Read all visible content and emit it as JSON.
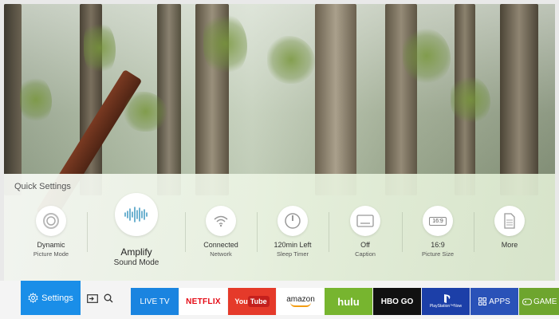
{
  "quick_settings": {
    "title": "Quick Settings",
    "items": [
      {
        "line1": "Dynamic",
        "line2": "Picture Mode",
        "icon": "picture-mode-icon"
      },
      {
        "line1": "Amplify",
        "line2": "Sound Mode",
        "icon": "sound-wave-icon"
      },
      {
        "line1": "Connected",
        "line2": "Network",
        "icon": "wifi-icon"
      },
      {
        "line1": "120min Left",
        "line2": "Sleep Timer",
        "icon": "timer-icon"
      },
      {
        "line1": "Off",
        "line2": "Caption",
        "icon": "caption-icon"
      },
      {
        "line1": "16:9",
        "line2": "Picture Size",
        "icon": "aspect-ratio-icon"
      },
      {
        "line1": "More",
        "line2": "",
        "icon": "document-icon"
      }
    ],
    "aspect_icon_text": "16:9"
  },
  "bar": {
    "settings_label": "Settings",
    "apps": {
      "live_tv": "LIVE TV",
      "netflix": "NETFLIX",
      "youtube_you": "You",
      "youtube_tube": "Tube",
      "amazon": "amazon",
      "hulu": "hulu",
      "hbo": "HBO GO",
      "playstation": "PlayStation™Now",
      "apps": "APPS",
      "game": "GAME"
    }
  },
  "colors": {
    "accent": "#1a8ee8",
    "hulu": "#77b52f",
    "netflix": "#e50914",
    "youtube": "#e53a2a"
  }
}
